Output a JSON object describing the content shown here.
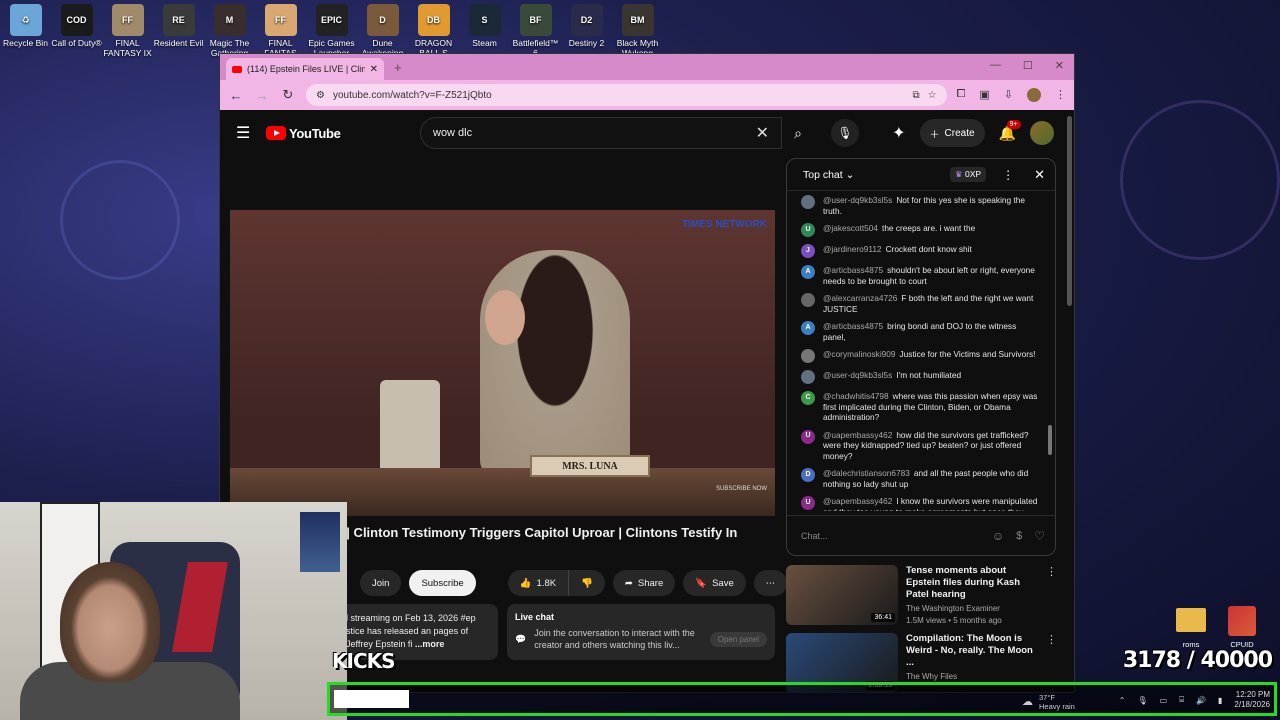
{
  "desktop": {
    "icons": [
      {
        "label": "Recycle Bin",
        "color": "#6aa6d8",
        "abbr": "♻"
      },
      {
        "label": "Call of Duty®",
        "color": "#1b1b1b",
        "abbr": "COD"
      },
      {
        "label": "FINAL FANTASY IX",
        "color": "#a08a6a",
        "abbr": "FF"
      },
      {
        "label": "Resident Evil",
        "color": "#3a3a3a",
        "abbr": "RE"
      },
      {
        "label": "Magic The Gathering",
        "color": "#3a2d2d",
        "abbr": "M"
      },
      {
        "label": "FINAL FANTAS",
        "color": "#d8a870",
        "abbr": "FF"
      },
      {
        "label": "Epic Games Launcher",
        "color": "#222",
        "abbr": "EPIC"
      },
      {
        "label": "Dune Awakening",
        "color": "#7a5a3a",
        "abbr": "D"
      },
      {
        "label": "DRAGON BALL S",
        "color": "#e09a30",
        "abbr": "DB"
      },
      {
        "label": "Steam",
        "color": "#1b2838",
        "abbr": "S"
      },
      {
        "label": "Battlefield™ 6",
        "color": "#3a4a3a",
        "abbr": "BF"
      },
      {
        "label": "Destiny 2",
        "color": "#2a2a4a",
        "abbr": "D2"
      },
      {
        "label": "Black Myth Wukong",
        "color": "#3a3530",
        "abbr": "BM"
      }
    ],
    "folder_label": "roms",
    "cpuid_label": "CPUID"
  },
  "browser": {
    "tab_title": "(114) Epstein Files LIVE | Clinton",
    "url": "youtube.com/watch?v=F-Z521jQbto"
  },
  "youtube": {
    "logo": "YouTube",
    "search_value": "wow dlc",
    "create_label": "Create",
    "notif_count": "9+"
  },
  "video": {
    "nameplate": "MRS. LUNA",
    "network_logo": "TIMES NETWORK",
    "subscribe_overlay": "SUBSCRIBE NOW",
    "title": "Epstein Files LIVE | Clinton Testimony Triggers Capitol Uproar | Clintons Testify In Court | World",
    "join_label": "Join",
    "subscribe_label": "Subscribe",
    "likes": "1.8K",
    "share_label": "Share",
    "save_label": "Save",
    "description": "l streaming on Feb 13, 2026 #ep stice has released an pages of Jeffrey Epstein fi",
    "description_more": "...more"
  },
  "live_chat_box": {
    "title": "Live chat",
    "text": "Join the conversation to interact with the creator and others watching this liv...",
    "open_label": "Open panel"
  },
  "chat": {
    "header": "Top chat",
    "xp": "0XP",
    "input_placeholder": "Chat...",
    "messages": [
      {
        "initial": "",
        "color": "#607080",
        "user": "@user-dq9kb3sl5s",
        "text": "Not for this yes she is speaking the truth."
      },
      {
        "initial": "U",
        "color": "#2e8b57",
        "user": "@jakescott504",
        "text": "the creeps are. i want the"
      },
      {
        "initial": "J",
        "color": "#7b4fc0",
        "user": "@jardinero9112",
        "text": "Crockett dont know shit"
      },
      {
        "initial": "A",
        "color": "#3a7fc4",
        "user": "@articbass4875",
        "text": "shouldn't be about left or right, everyone needs to be brought to court"
      },
      {
        "initial": "",
        "color": "#666",
        "user": "@alexcarranza4726",
        "text": "F both the left and the right we want JUSTICE"
      },
      {
        "initial": "A",
        "color": "#3a7fc4",
        "user": "@articbass4875",
        "text": "bring bondi and DOJ to the witness panel,"
      },
      {
        "initial": "",
        "color": "#777",
        "user": "@corymalinoski909",
        "text": "Justice for the Victims and Survivors!"
      },
      {
        "initial": "",
        "color": "#607080",
        "user": "@user-dq9kb3sl5s",
        "text": "I'm not humiliated"
      },
      {
        "initial": "C",
        "color": "#3a9a4a",
        "user": "@chadwhitis4798",
        "text": "where was this passion when epsy was first implicated during the Clinton, Biden, or Obama administration?"
      },
      {
        "initial": "U",
        "color": "#8a2a8a",
        "user": "@uapembassy462",
        "text": "how did the survivors get trafficked? were they kidnapped? tied up? beaten? or just offered money?"
      },
      {
        "initial": "D",
        "color": "#4a6fc0",
        "user": "@dalechristianson6783",
        "text": "and all the past people who did nothing so lady shut up"
      },
      {
        "initial": "U",
        "color": "#8a2a8a",
        "user": "@uapembassy462",
        "text": "I know the survivors were manipulated and they too young to make agreements but once they were used why would"
      }
    ]
  },
  "recommendations": [
    {
      "title": "Tense moments about Epstein files during Kash Patel hearing",
      "channel": "The Washington Examiner",
      "stats": "1.5M views • 5 months ago",
      "duration": "36:41",
      "color": "#6a5040"
    },
    {
      "title": "Compilation: The Moon is Weird - No, really. The Moon ...",
      "channel": "The Why Files",
      "stats": "",
      "duration": "2:38:13",
      "color": "#2a4a7a"
    }
  ],
  "overlay": {
    "kicks_label": "KICKS",
    "counter": "3178 / 40000",
    "progress_fraction": 0.0795
  },
  "tray": {
    "weather_temp": "37°F",
    "weather_desc": "Heavy rain",
    "time": "12:20 PM",
    "date": "2/18/2026"
  }
}
